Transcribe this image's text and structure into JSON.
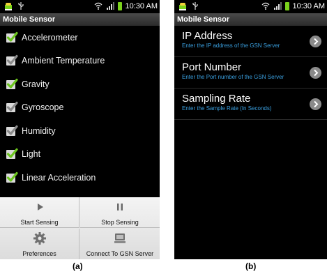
{
  "phone_a": {
    "status": {
      "time": "10:30 AM"
    },
    "title": "Mobile Sensor",
    "sensors": [
      {
        "label": "Accelerometer",
        "checked": true
      },
      {
        "label": "Ambient Temperature",
        "checked": false
      },
      {
        "label": "Gravity",
        "checked": true
      },
      {
        "label": "Gyroscope",
        "checked": false
      },
      {
        "label": "Humidity",
        "checked": false
      },
      {
        "label": "Light",
        "checked": true
      },
      {
        "label": "Linear Acceleration",
        "checked": true
      }
    ],
    "menu": {
      "start_label": "Start Sensing",
      "stop_label": "Stop Sensing",
      "prefs_label": "Preferences",
      "connect_label": "Connect To GSN Server"
    },
    "caption": "(a)"
  },
  "phone_b": {
    "status": {
      "time": "10:30 AM"
    },
    "title": "Mobile Sensor",
    "settings": [
      {
        "title": "IP Address",
        "summary": "Enter the IP address of the GSN Server"
      },
      {
        "title": "Port Number",
        "summary": "Enter the Port number of the GSN Server"
      },
      {
        "title": "Sampling Rate",
        "summary": "Enter the Sample Rate (In Seconds)"
      }
    ],
    "caption": "(b)"
  },
  "colors": {
    "checkbox_checked": "#6cc51e",
    "checkbox_unchecked": "#8c8c8c",
    "summary_text": "#3aa0e0",
    "battery": "#7bd21b"
  }
}
